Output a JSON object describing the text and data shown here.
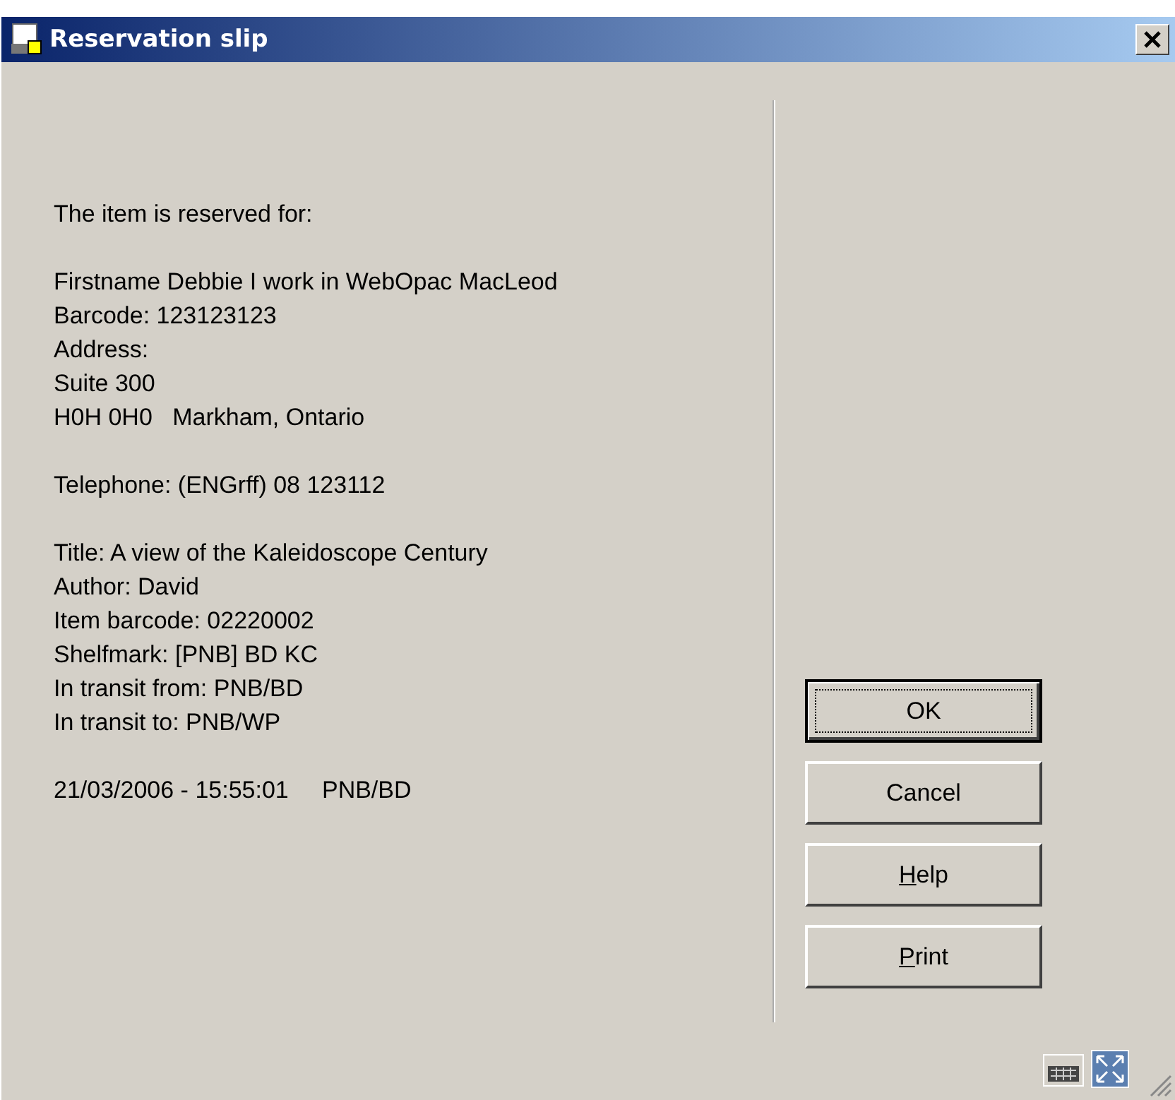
{
  "window": {
    "title": "Reservation slip"
  },
  "slip": [
    [
      "The item is reserved for:"
    ],
    [
      "Firstname Debbie I work in WebOpac MacLeod",
      "Barcode: 123123123",
      "Address:",
      "Suite 300",
      "H0H 0H0   Markham, Ontario"
    ],
    [
      "Telephone: (ENGrff) 08 123112"
    ],
    [
      "Title: A view of the Kaleidoscope Century",
      "Author: David",
      "Item barcode: 02220002",
      "Shelfmark: [PNB] BD KC",
      "In transit from: PNB/BD",
      "In transit to: PNB/WP"
    ],
    [
      "21/03/2006 - 15:55:01     PNB/BD"
    ]
  ],
  "buttons": [
    {
      "label": "OK",
      "default": true,
      "mnemonic": false
    },
    {
      "label": "Cancel",
      "default": false,
      "mnemonic": false
    },
    {
      "label": "Help",
      "default": false,
      "mnemonic": true
    },
    {
      "label": "Print",
      "default": false,
      "mnemonic": true
    }
  ]
}
